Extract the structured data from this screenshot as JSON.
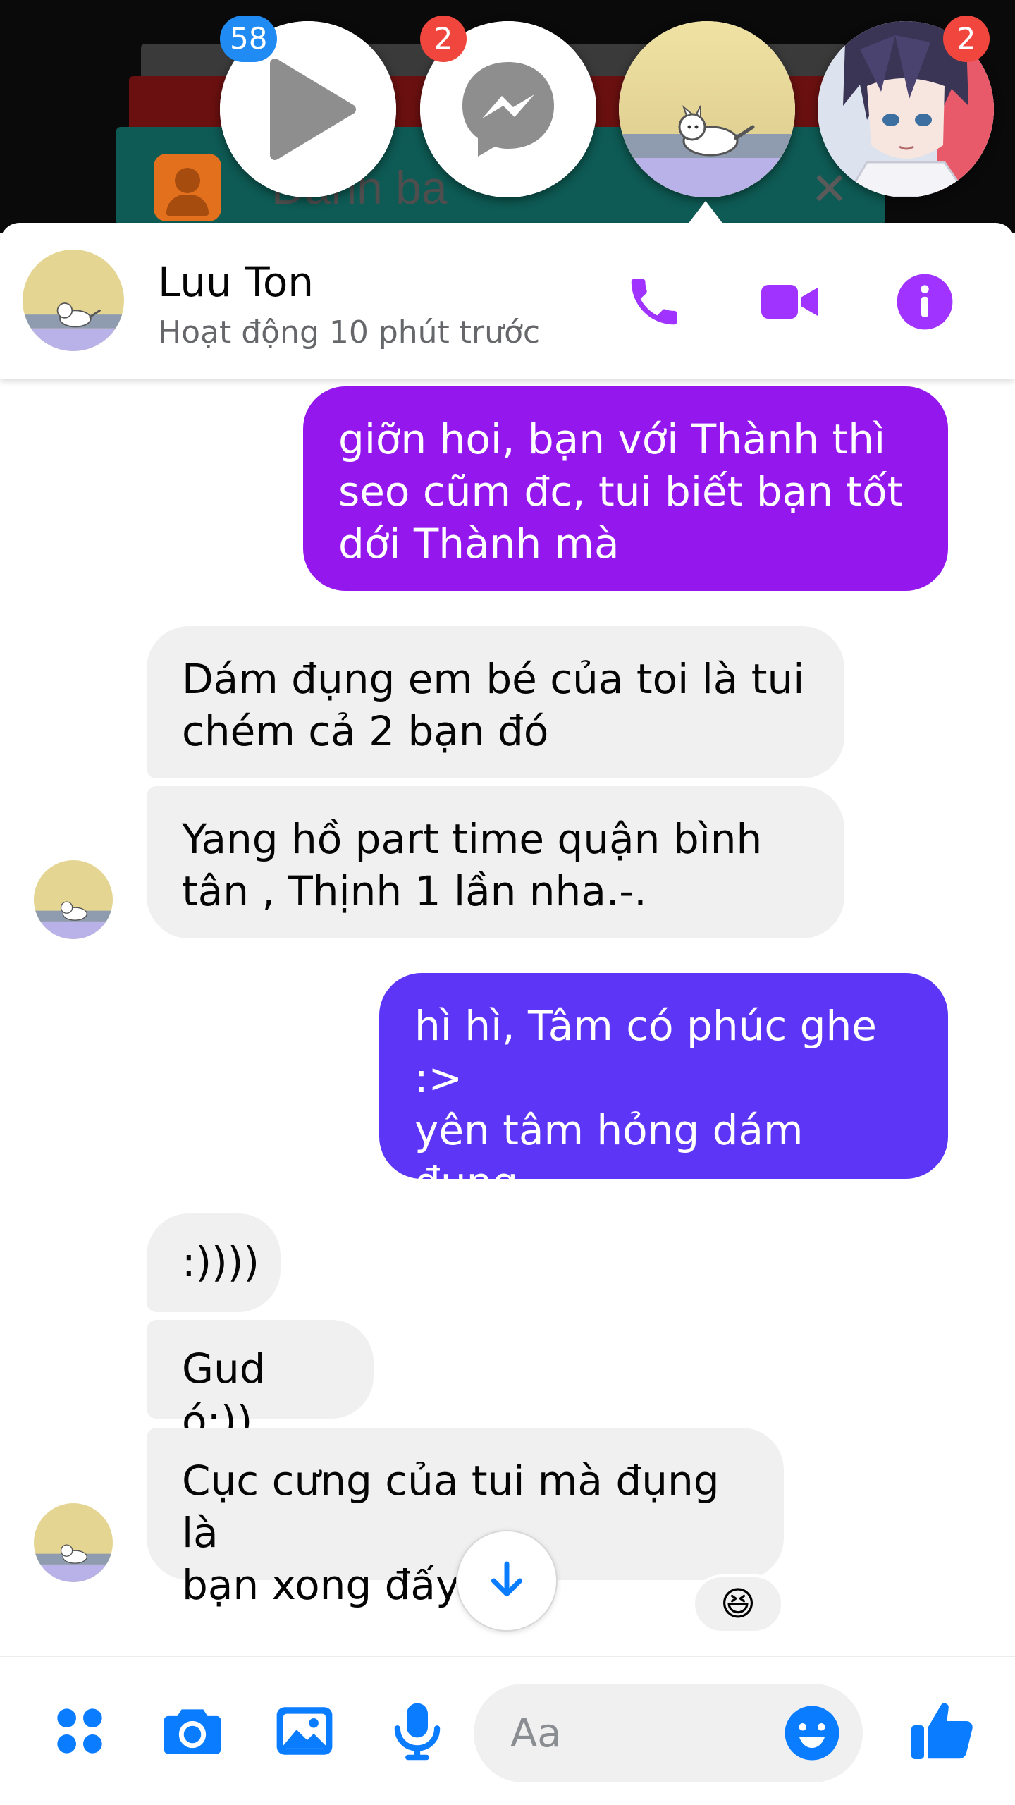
{
  "background_app": {
    "label": "Danh ba",
    "close_glyph": "✕"
  },
  "chat_heads": [
    {
      "name": "video-app-head",
      "badge": "58",
      "icon": "play-icon"
    },
    {
      "name": "messenger-head",
      "badge": "2",
      "icon": "messenger-icon"
    },
    {
      "name": "luu-ton-head",
      "badge": "",
      "icon": "avatar-cat"
    },
    {
      "name": "anime-contact-head",
      "badge": "2",
      "icon": "avatar-anime"
    }
  ],
  "header": {
    "name": "Luu Ton",
    "status": "Hoạt động 10 phút trước",
    "accent_color": "#a033ff"
  },
  "messages": [
    {
      "side": "out",
      "text": "giỡn hoi, bạn với Thành thì\nseo cũm đc, tui biết bạn tốt\ndới Thành mà",
      "color": "#9417ee"
    },
    {
      "side": "in",
      "text": "Dám đụng em bé của toi là tui\nchém cả 2 bạn đó"
    },
    {
      "side": "in",
      "text": "Yang hồ part time quận bình\ntân , Thịnh 1 lần nha.-."
    },
    {
      "side": "out",
      "text": "hì hì, Tâm có phúc ghe :>\nyên tâm hỏng dám đụng\ntâm đâu",
      "color": "#5c35f6"
    },
    {
      "side": "in",
      "text": ":))))"
    },
    {
      "side": "in",
      "text": "Gud ó:))"
    },
    {
      "side": "in",
      "text": "Cục cưng của tui mà đụng là\nbạn xong đấy .-",
      "reaction": "😆"
    }
  ],
  "composer": {
    "placeholder": "Aa",
    "value": "",
    "icons": [
      "more-icon",
      "camera-icon",
      "gallery-icon",
      "microphone-icon",
      "emoji-icon",
      "thumbs-up-icon"
    ],
    "icon_color": "#0a7cff"
  }
}
